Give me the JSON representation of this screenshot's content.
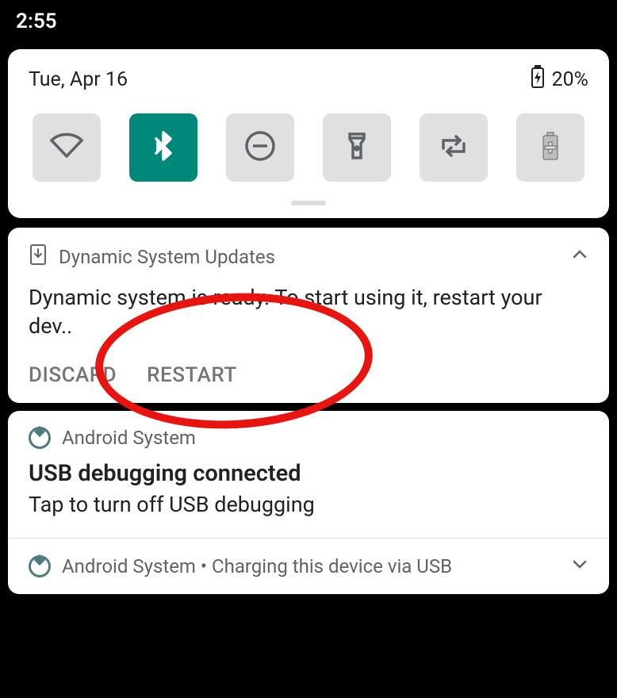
{
  "status_bar": {
    "time": "2:55"
  },
  "quick_settings": {
    "date": "Tue, Apr 16",
    "battery_pct": "20%",
    "tiles": {
      "wifi": "wifi-icon",
      "bluetooth": "bluetooth-icon",
      "dnd": "dnd-icon",
      "flashlight": "flashlight-icon",
      "rotate": "auto-rotate-icon",
      "battery_saver": "battery-saver-icon"
    }
  },
  "notif_dsu": {
    "app": "Dynamic System Updates",
    "body": "Dynamic system is ready. To start using it, restart your dev..",
    "actions": {
      "discard": "DISCARD",
      "restart": "RESTART"
    }
  },
  "notif_sys": {
    "app": "Android System",
    "title": "USB debugging connected",
    "subtitle": "Tap to turn off USB debugging",
    "collapsed": "Android System  •  Charging this device via USB"
  }
}
